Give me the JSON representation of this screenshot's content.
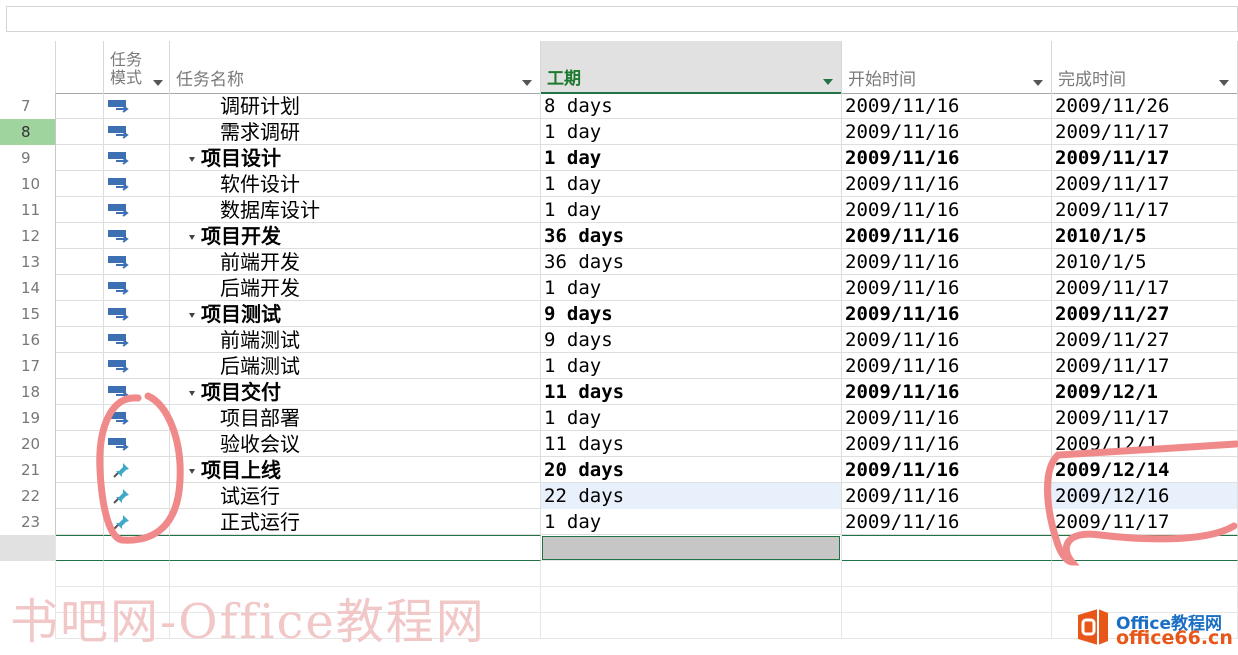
{
  "header": {
    "mode_label_line1": "任务",
    "mode_label_line2": "模式",
    "name_label": "任务名称",
    "duration_label": "工期",
    "start_label": "开始时间",
    "finish_label": "完成时间"
  },
  "rows": [
    {
      "id": "7",
      "name": "调研计划",
      "duration": "8 days",
      "start": "2009/11/16",
      "finish": "2009/11/26",
      "mode": "auto"
    },
    {
      "id": "8",
      "name": "需求调研",
      "duration": "1 day",
      "start": "2009/11/16",
      "finish": "2009/11/17",
      "mode": "auto"
    },
    {
      "id": "9",
      "name": "项目设计",
      "duration": "1 day",
      "start": "2009/11/16",
      "finish": "2009/11/17",
      "mode": "auto"
    },
    {
      "id": "10",
      "name": "软件设计",
      "duration": "1 day",
      "start": "2009/11/16",
      "finish": "2009/11/17",
      "mode": "auto"
    },
    {
      "id": "11",
      "name": "数据库设计",
      "duration": "1 day",
      "start": "2009/11/16",
      "finish": "2009/11/17",
      "mode": "auto"
    },
    {
      "id": "12",
      "name": "项目开发",
      "duration": "36 days",
      "start": "2009/11/16",
      "finish": "2010/1/5",
      "mode": "auto"
    },
    {
      "id": "13",
      "name": "前端开发",
      "duration": "36 days",
      "start": "2009/11/16",
      "finish": "2010/1/5",
      "mode": "auto"
    },
    {
      "id": "14",
      "name": "后端开发",
      "duration": "1 day",
      "start": "2009/11/16",
      "finish": "2009/11/17",
      "mode": "auto"
    },
    {
      "id": "15",
      "name": "项目测试",
      "duration": "9 days",
      "start": "2009/11/16",
      "finish": "2009/11/27",
      "mode": "auto"
    },
    {
      "id": "16",
      "name": "前端测试",
      "duration": "9 days",
      "start": "2009/11/16",
      "finish": "2009/11/27",
      "mode": "auto"
    },
    {
      "id": "17",
      "name": "后端测试",
      "duration": "1 day",
      "start": "2009/11/16",
      "finish": "2009/11/17",
      "mode": "auto"
    },
    {
      "id": "18",
      "name": "项目交付",
      "duration": "11 days",
      "start": "2009/11/16",
      "finish": "2009/12/1",
      "mode": "auto"
    },
    {
      "id": "19",
      "name": "项目部署",
      "duration": "1 day",
      "start": "2009/11/16",
      "finish": "2009/11/17",
      "mode": "auto"
    },
    {
      "id": "20",
      "name": "验收会议",
      "duration": "11 days",
      "start": "2009/11/16",
      "finish": "2009/12/1",
      "mode": "auto"
    },
    {
      "id": "21",
      "name": "项目上线",
      "duration": "20 days",
      "start": "2009/11/16",
      "finish": "2009/12/14",
      "mode": "manual"
    },
    {
      "id": "22",
      "name": "试运行",
      "duration": "22 days",
      "start": "2009/11/16",
      "finish": "2009/12/16",
      "mode": "manual"
    },
    {
      "id": "23",
      "name": "正式运行",
      "duration": "1 day",
      "start": "2009/11/16",
      "finish": "2009/11/17",
      "mode": "manual"
    }
  ],
  "icons": {
    "info": "info-icon",
    "auto_scheduled": "auto-scheduled-task-icon",
    "manual_scheduled": "manual-scheduled-pin-icon"
  },
  "colors": {
    "selected_header_text": "#1e7a2e",
    "selected_row_id": "#9fd49f",
    "annotation": "#f08a8a",
    "highlight_cell": "#e8f0fb"
  },
  "watermark": {
    "text": "书吧网-Office教程网",
    "logo_line1": "Office教程网",
    "logo_line2": "office66.cn"
  }
}
